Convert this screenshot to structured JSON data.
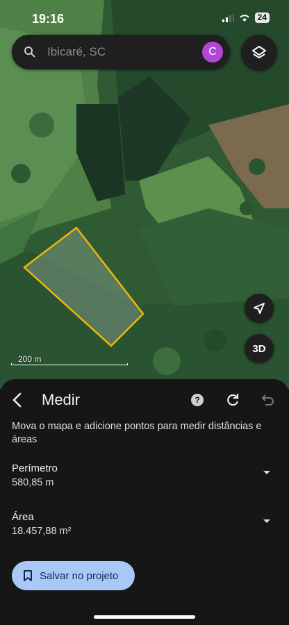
{
  "status_bar": {
    "time": "19:16",
    "battery": "24"
  },
  "search": {
    "placeholder": "Ibicaré, SC",
    "avatar_letter": "C"
  },
  "map": {
    "scale_label": "200 m",
    "three_d_label": "3D",
    "polygon_color": "#f2b705"
  },
  "panel": {
    "title": "Medir",
    "description": "Mova o mapa e adicione pontos para medir distâncias e áreas",
    "perimeter": {
      "label": "Perímetro",
      "value": "580,85 m"
    },
    "area": {
      "label": "Área",
      "value": "18.457,88 m²"
    },
    "save_label": "Salvar no projeto"
  },
  "colors": {
    "sheet_bg": "#161616",
    "button_bg": "#a9c8f7",
    "avatar": "#b249d6"
  }
}
